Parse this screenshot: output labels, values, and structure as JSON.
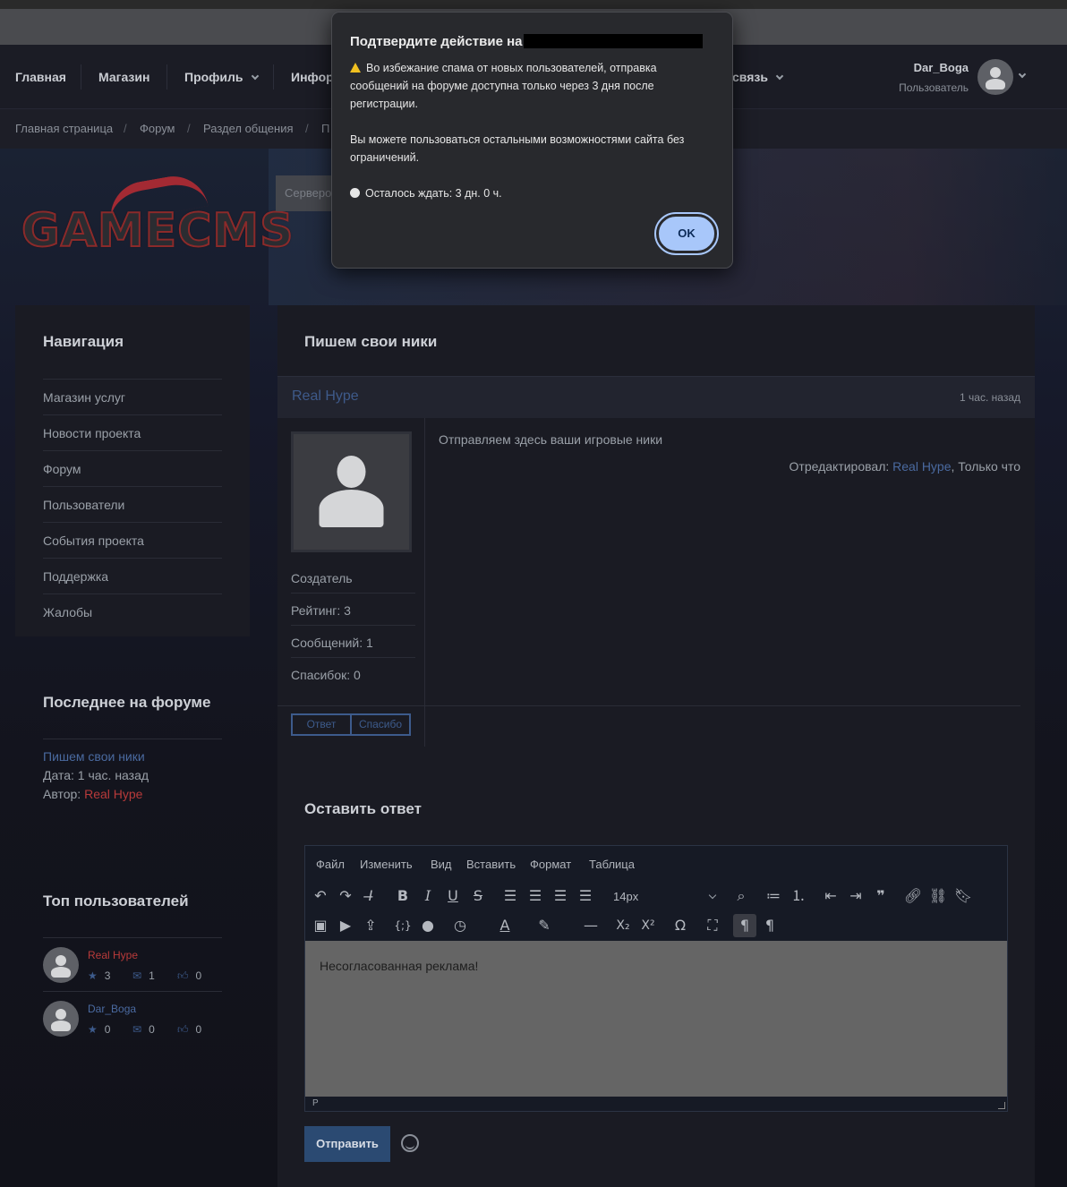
{
  "nav": {
    "items": [
      "Главная",
      "Магазин",
      "Профиль",
      "Инфор",
      "связь"
    ],
    "user_name": "Dar_Boga",
    "user_role": "Пользователь"
  },
  "breadcrumbs": [
    "Главная страница",
    "Форум",
    "Раздел общения",
    "П"
  ],
  "logo_text": "GAMECMS",
  "search_placeholder": "Серверо",
  "sidebar": {
    "nav_title": "Навигация",
    "nav_items": [
      "Магазин услуг",
      "Новости проекта",
      "Форум",
      "Пользователи",
      "События проекта",
      "Поддержка",
      "Жалобы"
    ],
    "latest_title": "Последнее на форуме",
    "latest_topic": "Пишем свои ники",
    "latest_date": "Дата: 1 час. назад",
    "latest_author_label": "Автор: ",
    "latest_author": "Real Hype",
    "top_title": "Топ пользователей",
    "top_users": [
      {
        "name": "Real Hype",
        "rating": "3",
        "messages": "1",
        "thanks": "0"
      },
      {
        "name": "Dar_Boga",
        "rating": "0",
        "messages": "0",
        "thanks": "0"
      }
    ]
  },
  "topic": {
    "title": "Пишем свои ники",
    "author": "Real Hype",
    "time": "1 час. назад",
    "text": "Отправляем здесь ваши игровые ники",
    "edited_label": "Отредактировал: ",
    "edited_by": "Real Hype",
    "edited_when": ", Только что",
    "role": "Создатель",
    "rating": "Рейтинг: 3",
    "messages": "Сообщений: 1",
    "thanks": "Спасибок: 0",
    "reply_btn": "Ответ",
    "thanks_btn": "Спасибо"
  },
  "reply": {
    "title": "Оставить ответ",
    "menu": [
      "Файл",
      "Изменить",
      "Вид",
      "Вставить",
      "Формат",
      "Таблица"
    ],
    "font_size": "14px",
    "content": "Несогласованная реклама!",
    "status_path": "P",
    "send_btn": "Отправить"
  },
  "modal": {
    "title": "Подтвердите действие на",
    "warning": "Во избежание спама от новых пользователей, отправка сообщений на форуме доступна только через 3 дня после регистрации.",
    "info": "Вы можете пользоваться остальными возможностями сайта без ограничений.",
    "timer": "Осталось ждать: 3 дн. 0 ч.",
    "ok": "OK"
  },
  "colors": {
    "accent_blue": "#3d5b8c",
    "accent_red": "#b83a3a",
    "ok_button": "#a8c7fa"
  }
}
